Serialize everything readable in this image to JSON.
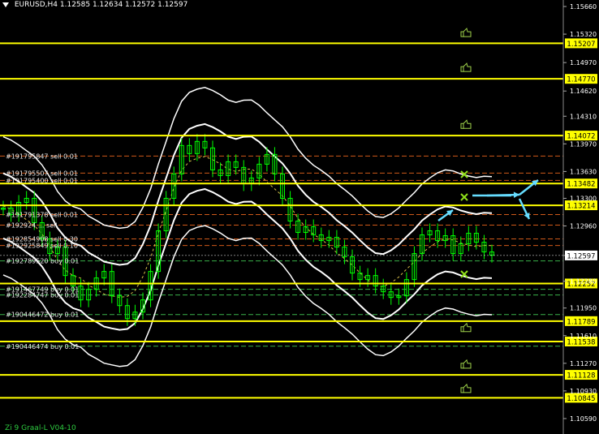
{
  "header": {
    "symbol": "EURUSD,H4",
    "ohlc": "1.12585 1.12634 1.12572 1.12597"
  },
  "footer": {
    "label": "Zi 9 Graal-L V04-10"
  },
  "colors": {
    "background": "#000000",
    "candle": "#00ff00",
    "level": "#ffff00",
    "band": "#ffffff",
    "arrow": "#66ddff",
    "axis_text": "#ffffff"
  },
  "chart_data": {
    "type": "line",
    "y_axis": {
      "range": [
        1.104,
        1.1574
      ],
      "ticks": [
        "1.15660",
        "1.15320",
        "1.14970",
        "1.14620",
        "1.14310",
        "1.13970",
        "1.13630",
        "1.13300",
        "1.12960",
        "1.12597",
        "1.12280",
        "1.11950",
        "1.11610",
        "1.11270",
        "1.10930",
        "1.10590"
      ]
    },
    "price_levels": [
      {
        "value": 1.15207,
        "label": "1.15207"
      },
      {
        "value": 1.1477,
        "label": "1.14770"
      },
      {
        "value": 1.14072,
        "label": "1.14072"
      },
      {
        "value": 1.13482,
        "label": "1.13482"
      },
      {
        "value": 1.13214,
        "label": "1.13214"
      },
      {
        "value": 1.12252,
        "label": "1.12252"
      },
      {
        "value": 1.11789,
        "label": "1.11789"
      },
      {
        "value": 1.11538,
        "label": "1.11538"
      },
      {
        "value": 1.11128,
        "label": "1.11128"
      },
      {
        "value": 1.10845,
        "label": "1.10845"
      }
    ],
    "current_price": {
      "value": 1.12597,
      "label": "1.12597"
    },
    "orders": [
      {
        "label": "#191795847 sell 0.01",
        "price": 1.1382
      },
      {
        "label": "#191795507 sell 0.01",
        "price": 1.1361
      },
      {
        "label": "#191795400 sell 0.01",
        "price": 1.1352
      },
      {
        "label": "#191791378 sell 0.01",
        "price": 1.131
      },
      {
        "label": "#192924 ... sell",
        "price": 1.1297
      },
      {
        "label": "#192854908 sell 0.30",
        "price": 1.128
      },
      {
        "label": "#192925849 sell 0.10",
        "price": 1.1272
      },
      {
        "label": "#192789520 buy 0.01",
        "price": 1.1253
      },
      {
        "label": "#191467749 buy 0.01",
        "price": 1.1218
      },
      {
        "label": "#192284747 buy 0.01",
        "price": 1.1211
      },
      {
        "label": "#190446472 buy 0.01",
        "price": 1.1187
      },
      {
        "label": "#190446474 buy 0.01",
        "price": 1.1148
      }
    ],
    "close_series": [
      1.1318,
      1.131,
      1.1325,
      1.133,
      1.13,
      1.128,
      1.1262,
      1.127,
      1.1235,
      1.1222,
      1.1205,
      1.1218,
      1.1232,
      1.124,
      1.121,
      1.1198,
      1.1182,
      1.119,
      1.1205,
      1.124,
      1.129,
      1.133,
      1.136,
      1.1395,
      1.1385,
      1.14,
      1.1392,
      1.1365,
      1.1358,
      1.1375,
      1.1368,
      1.1348,
      1.1355,
      1.1372,
      1.1384,
      1.136,
      1.133,
      1.1302,
      1.1288,
      1.1295,
      1.1285,
      1.1278,
      1.1282,
      1.127,
      1.1258,
      1.1238,
      1.123,
      1.1235,
      1.1222,
      1.1215,
      1.1208,
      1.121,
      1.123,
      1.1262,
      1.1285,
      1.129,
      1.1278,
      1.1284,
      1.1262,
      1.1274,
      1.1287,
      1.1276,
      1.1264,
      1.126
    ]
  }
}
